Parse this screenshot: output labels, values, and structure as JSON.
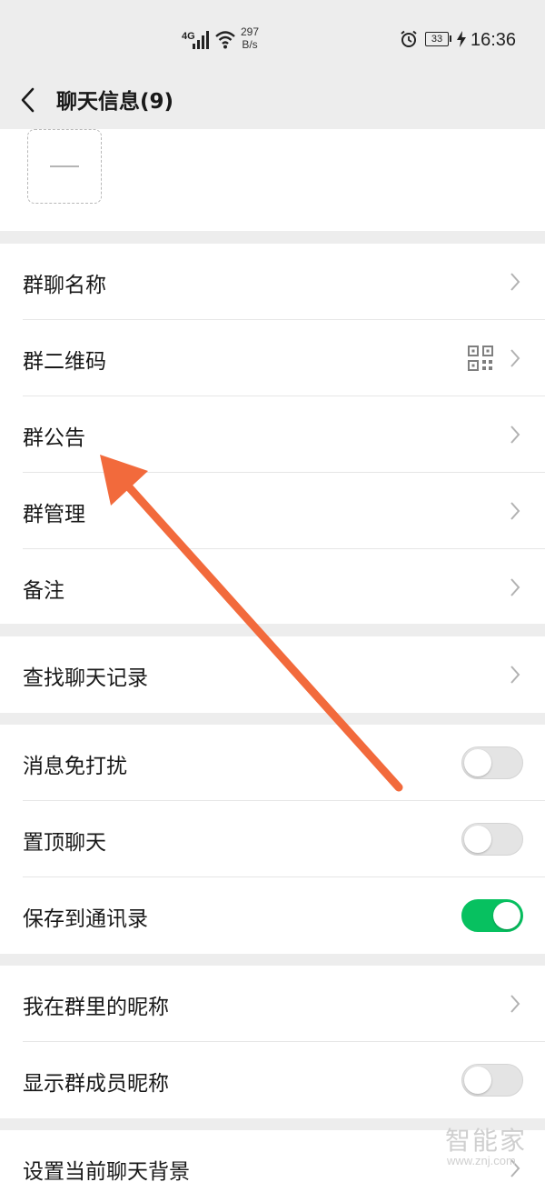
{
  "status_bar": {
    "network_type": "4G",
    "net_speed_value": "297",
    "net_speed_unit": "B/s",
    "battery_level": "33",
    "time": "16:36",
    "icons": [
      "signal-icon",
      "wifi-icon",
      "alarm-icon",
      "battery-icon",
      "charging-icon"
    ]
  },
  "header": {
    "title": "聊天信息(9)",
    "back_icon": "back-chevron-icon"
  },
  "settings_groups": [
    {
      "items": [
        {
          "label": "群聊名称",
          "control": "chevron"
        },
        {
          "label": "群二维码",
          "control": "qr-chevron"
        },
        {
          "label": "群公告",
          "control": "chevron"
        },
        {
          "label": "群管理",
          "control": "chevron"
        },
        {
          "label": "备注",
          "control": "chevron"
        }
      ]
    },
    {
      "items": [
        {
          "label": "查找聊天记录",
          "control": "chevron"
        }
      ]
    },
    {
      "items": [
        {
          "label": "消息免打扰",
          "control": "toggle",
          "enabled": false
        },
        {
          "label": "置顶聊天",
          "control": "toggle",
          "enabled": false
        },
        {
          "label": "保存到通讯录",
          "control": "toggle",
          "enabled": true
        }
      ]
    },
    {
      "items": [
        {
          "label": "我在群里的昵称",
          "control": "chevron"
        },
        {
          "label": "显示群成员昵称",
          "control": "toggle",
          "enabled": false
        }
      ]
    },
    {
      "items": [
        {
          "label": "设置当前聊天背景",
          "control": "chevron"
        }
      ]
    }
  ],
  "watermark": {
    "logo_text": "智能家",
    "url": "www.znj.com"
  },
  "colors": {
    "toggle_on": "#07c160",
    "annotation_arrow": "#f26a3c"
  }
}
